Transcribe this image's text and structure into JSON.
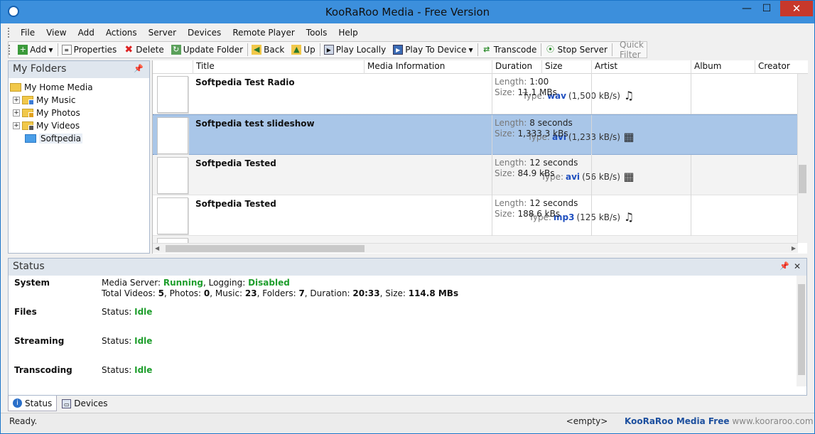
{
  "window": {
    "title": "KooRaRoo Media - Free Version",
    "controls": {
      "minimize": "—",
      "maximize": "☐",
      "close": "✕"
    }
  },
  "menu": [
    "File",
    "View",
    "Add",
    "Actions",
    "Server",
    "Devices",
    "Remote Player",
    "Tools",
    "Help"
  ],
  "toolbar": {
    "add": "Add",
    "properties": "Properties",
    "delete": "Delete",
    "update_folder": "Update Folder",
    "back": "Back",
    "up": "Up",
    "play_locally": "Play Locally",
    "play_to_device": "Play To Device",
    "transcode": "Transcode",
    "stop_server": "Stop Server",
    "quick_filter_placeholder": "Quick Filter"
  },
  "folders": {
    "title": "My Folders",
    "items": [
      {
        "label": "My Home Media"
      },
      {
        "label": "My Music"
      },
      {
        "label": "My Photos"
      },
      {
        "label": "My Videos"
      },
      {
        "label": "Softpedia"
      }
    ]
  },
  "columns": [
    "Title",
    "Media Information",
    "Duration",
    "Size",
    "Artist",
    "Album",
    "Creator"
  ],
  "media": [
    {
      "title": "Softpedia Test Radio",
      "type_label": "Type:",
      "ext": "wav",
      "rate": "(1,500 kB/s)",
      "icon": "music-note",
      "length_label": "Length:",
      "length": "1:00",
      "size_label": "Size:",
      "size": "11.1 MBs"
    },
    {
      "title": "Softpedia test slideshow",
      "type_label": "Type:",
      "ext": "avi",
      "rate": "(1,233 kB/s)",
      "icon": "film",
      "length_label": "Length:",
      "length": "8 seconds",
      "size_label": "Size:",
      "size": "1,333.3 kBs"
    },
    {
      "title": "Softpedia Tested",
      "type_label": "Type:",
      "ext": "avi",
      "rate": "(56 kB/s)",
      "icon": "film",
      "length_label": "Length:",
      "length": "12 seconds",
      "size_label": "Size:",
      "size": "84.9 kBs"
    },
    {
      "title": "Softpedia Tested",
      "type_label": "Type:",
      "ext": "mp3",
      "rate": "(125 kB/s)",
      "icon": "music-note",
      "length_label": "Length:",
      "length": "12 seconds",
      "size_label": "Size:",
      "size": "188.6 kBs"
    }
  ],
  "status": {
    "title": "Status",
    "system_label": "System",
    "server_prefix": "Media Server: ",
    "server_state": "Running",
    "logging_prefix": ", Logging: ",
    "logging_state": "Disabled",
    "totals": {
      "videos_label": "Total Videos: ",
      "videos": "5",
      "photos_label": ", Photos: ",
      "photos": "0",
      "music_label": ", Music: ",
      "music": "23",
      "folders_label": ", Folders: ",
      "folders": "7",
      "duration_label": ", Duration: ",
      "duration": "20:33",
      "size_label": ", Size: ",
      "size": "114.8 MBs"
    },
    "files_label": "Files",
    "streaming_label": "Streaming",
    "transcoding_label": "Transcoding",
    "status_prefix": "Status: ",
    "files_state": "Idle",
    "streaming_state": "Idle",
    "transcoding_state": "Idle"
  },
  "tabs": {
    "status": "Status",
    "devices": "Devices"
  },
  "statusbar": {
    "left": "Ready.",
    "middle": "<empty>",
    "brand": "KooRaRoo Media Free",
    "url": "www.kooraroo.com"
  }
}
